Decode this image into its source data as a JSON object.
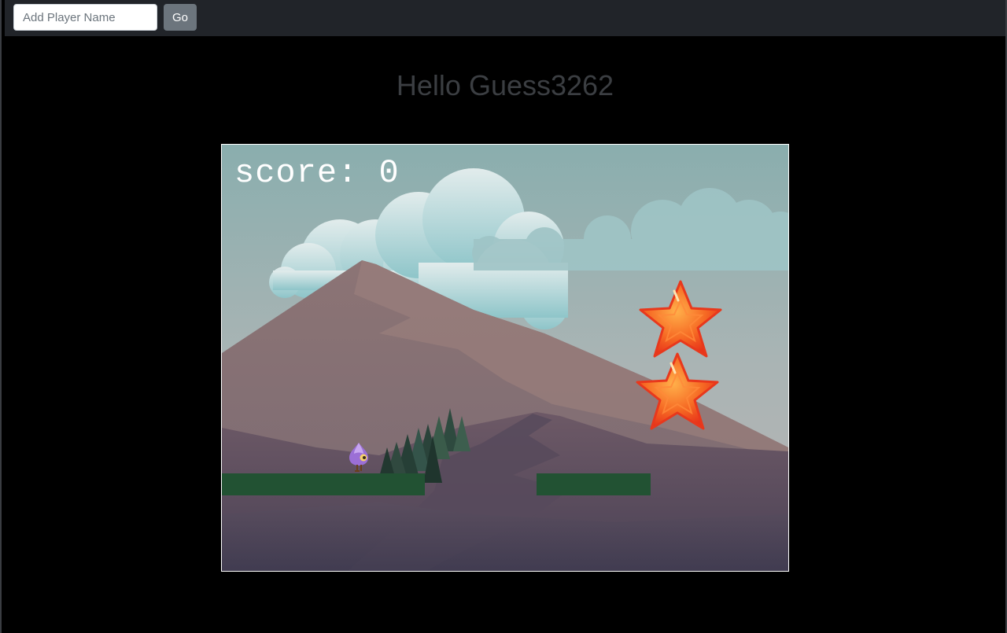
{
  "navbar": {
    "player_input_value": "",
    "player_input_placeholder": "Add Player Name",
    "go_label": "Go"
  },
  "greeting": "Hello Guess3262",
  "game": {
    "score_label": "score:",
    "score_value": "0",
    "objects": [
      "player-character",
      "star-collectible",
      "star-collectible",
      "green-platform",
      "green-platform"
    ]
  },
  "colors": {
    "navbar_bg": "#212429",
    "go_button_bg": "#6c757d",
    "platform": "#225233",
    "star": "#f25a1e",
    "sky": "#8fb3b3"
  }
}
